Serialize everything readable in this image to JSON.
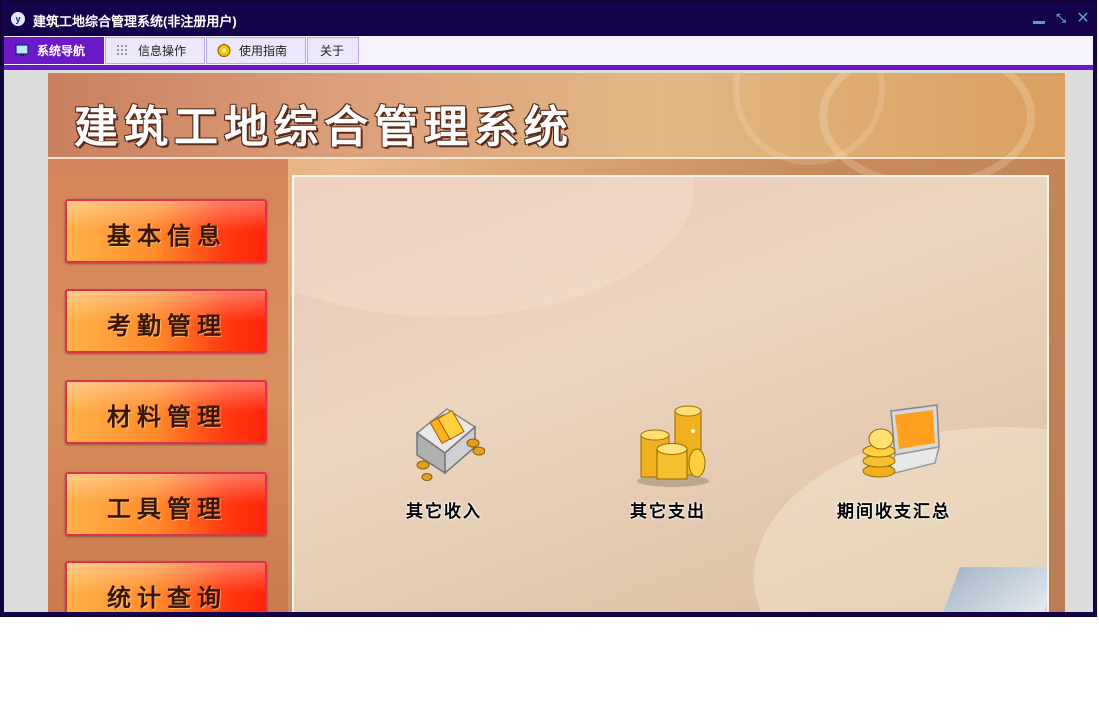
{
  "window": {
    "title": "建筑工地综合管理系统(非注册用户)",
    "icon": "app-logo-icon",
    "controls": [
      "minimize-icon",
      "restore-icon",
      "close-icon"
    ]
  },
  "tabs": [
    {
      "label": "系统导航",
      "icon": "monitor-icon",
      "active": true
    },
    {
      "label": "信息操作",
      "icon": "grid-icon",
      "active": false
    },
    {
      "label": "使用指南",
      "icon": "help-disc-icon",
      "active": false
    },
    {
      "label": "关于",
      "icon": "",
      "active": false
    }
  ],
  "banner": {
    "title": "建筑工地综合管理系统"
  },
  "sidebar": {
    "items": [
      {
        "label": "基本信息"
      },
      {
        "label": "考勤管理"
      },
      {
        "label": "材料管理"
      },
      {
        "label": "工具管理"
      },
      {
        "label": "统计查询"
      }
    ]
  },
  "main": {
    "functions": [
      {
        "label": "其它收入",
        "icon": "income-safe-icon"
      },
      {
        "label": "其它支出",
        "icon": "coin-stack-icon"
      },
      {
        "label": "期间收支汇总",
        "icon": "laptop-coins-icon"
      }
    ]
  },
  "colors": {
    "titlebar": "#14034a",
    "tab_active": "#6a18c8",
    "menu_button_start": "#ffb24a",
    "menu_button_end": "#ff2408"
  }
}
